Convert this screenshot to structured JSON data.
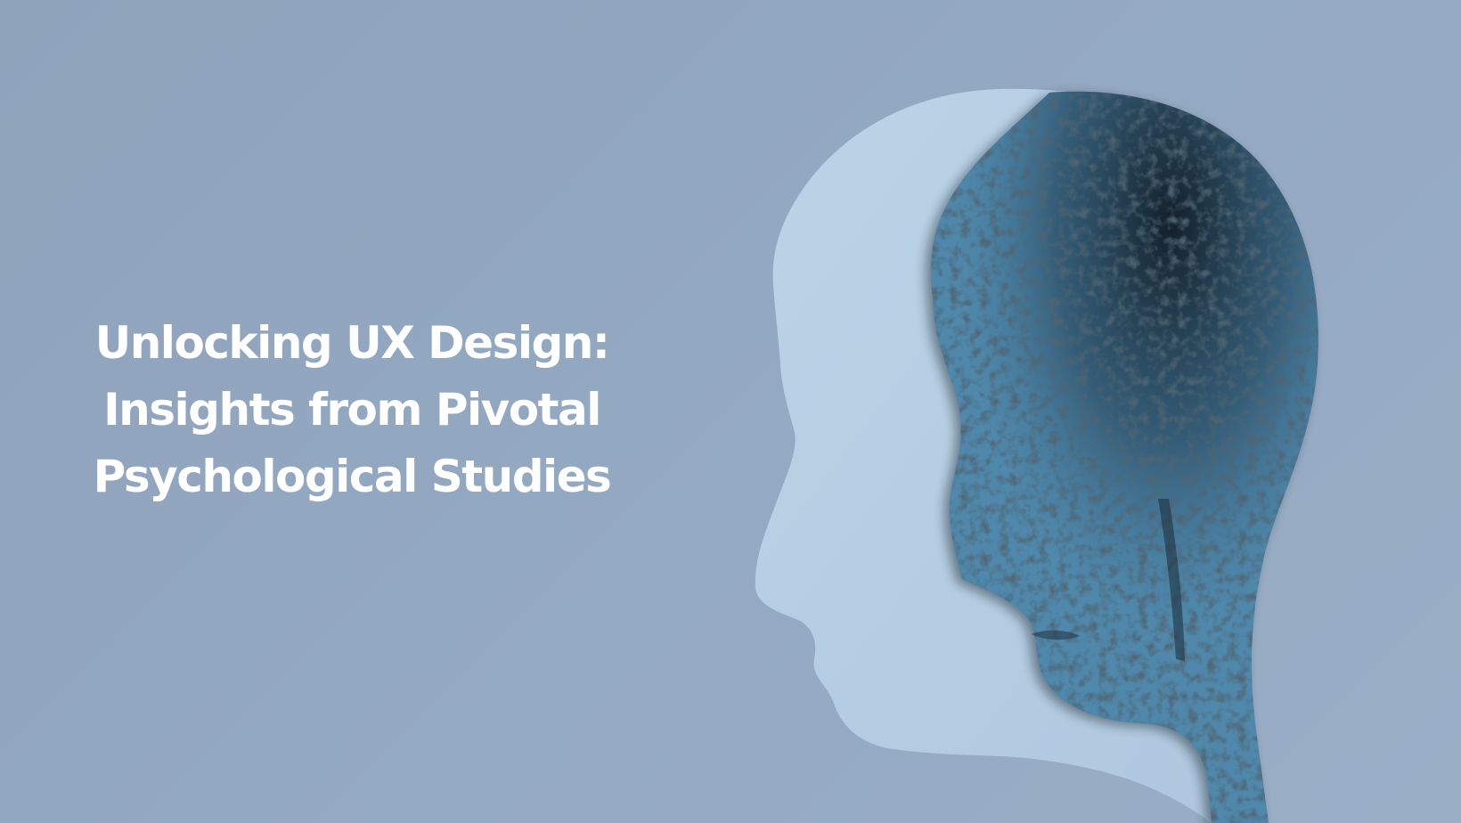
{
  "hero": {
    "title_lines": [
      "Unlocking UX Design:",
      "Insights from Pivotal",
      "Psychological Studies"
    ]
  },
  "illustration": {
    "name": "paper-cut-head-silhouette",
    "colors": {
      "background": "#93a8c1",
      "light_profile": "#b4cde3",
      "textured_head_base": "#4e86a8",
      "textured_head_dark": "#16222c"
    }
  }
}
